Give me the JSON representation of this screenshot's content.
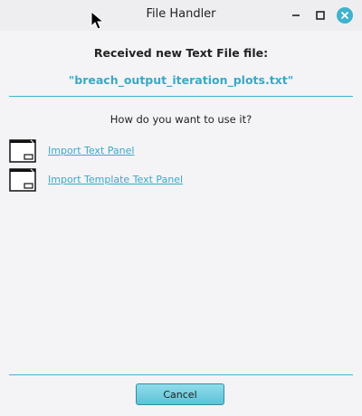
{
  "window": {
    "title": "File Handler"
  },
  "dialog": {
    "heading": "Received new Text File file:",
    "filename": "\"breach_output_iteration_plots.txt\"",
    "question": "How do you want to use it?",
    "options": [
      {
        "label": "Import Text Panel",
        "icon": "window-panel-icon"
      },
      {
        "label": "Import Template Text Panel",
        "icon": "window-panel-icon"
      }
    ],
    "cancel_label": "Cancel"
  },
  "colors": {
    "accent": "#3aa8c6",
    "close_button": "#3fb2cc"
  }
}
